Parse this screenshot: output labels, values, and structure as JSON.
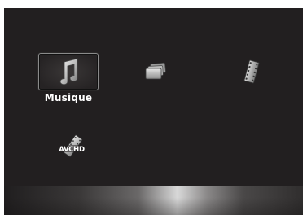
{
  "menu": {
    "items": [
      {
        "label": "Musique",
        "icon": "music-note-icon",
        "selected": true
      },
      {
        "label": "",
        "icon": "photos-icon",
        "selected": false
      },
      {
        "label": "",
        "icon": "film-strip-icon",
        "selected": false
      },
      {
        "label": "",
        "icon": "avchd-icon",
        "selected": false
      }
    ],
    "avchd_logo_text": "AVCHD"
  },
  "colors": {
    "background": "#221f20",
    "label": "#ffffff",
    "selection_border": "#8a8a8a"
  }
}
